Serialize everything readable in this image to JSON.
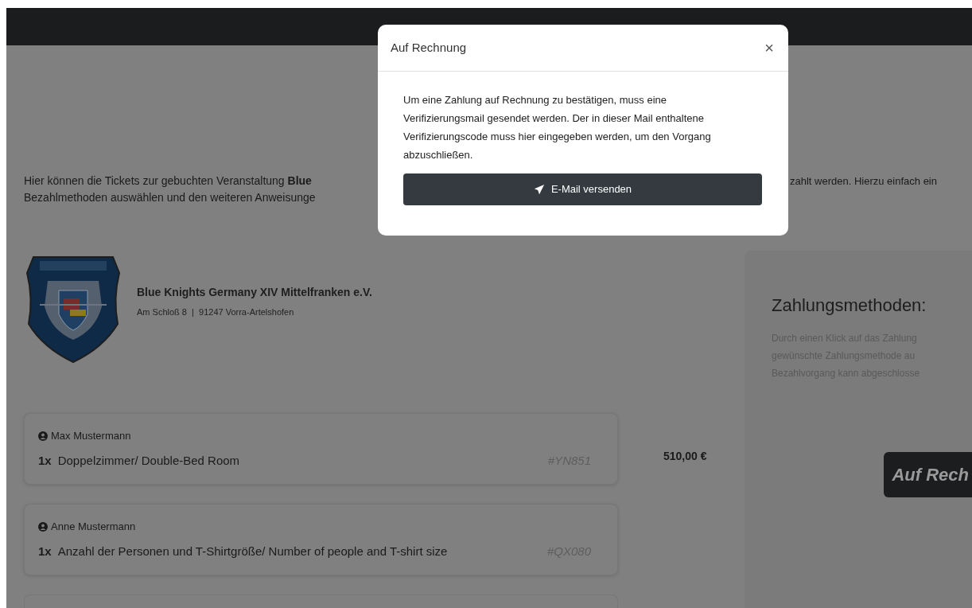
{
  "intro": {
    "left_lines": [
      "Hier können die Tickets zur gebuchten Veranstaltung **Blue**",
      "Bezahlmethoden auswählen und den weiteren Anweisunge"
    ],
    "right_fragment": "zahlt werden. Hierzu einfach ein"
  },
  "organizer": {
    "name": "Blue Knights Germany XIV Mittelfranken e.V.",
    "address": "Am Schloß 8  |  91247 Vorra-Artelshofen"
  },
  "tickets": [
    {
      "holder": "Max Mustermann",
      "quantity": "1x",
      "item": "Doppelzimmer/ Double-Bed Room",
      "code": "#YN851"
    },
    {
      "holder": "Anne Mustermann",
      "quantity": "1x",
      "item": "Anzahl der Personen und T-Shirtgröße/ Number of people and T-shirt size",
      "code": "#QX080"
    }
  ],
  "total": "510,00 €",
  "payment_panel": {
    "title": "Zahlungsmethoden:",
    "description_lines": [
      "Durch einen Klick auf das Zahlung",
      "gewünschte Zahlungsmethode au",
      "Bezahlvorgang kann abgeschlosse"
    ],
    "methods": [
      {
        "label": "Auf Rech"
      }
    ]
  },
  "modal": {
    "title": "Auf Rechnung",
    "close": "×",
    "body": "Um eine Zahlung auf Rechnung zu bestätigen, muss eine Verifizierungsmail gesendet werden. Der in dieser Mail enthaltene Verifizierungscode muss hier eingegeben werden, um den Vorgang abzuschließen.",
    "button": "E-Mail versenden"
  }
}
